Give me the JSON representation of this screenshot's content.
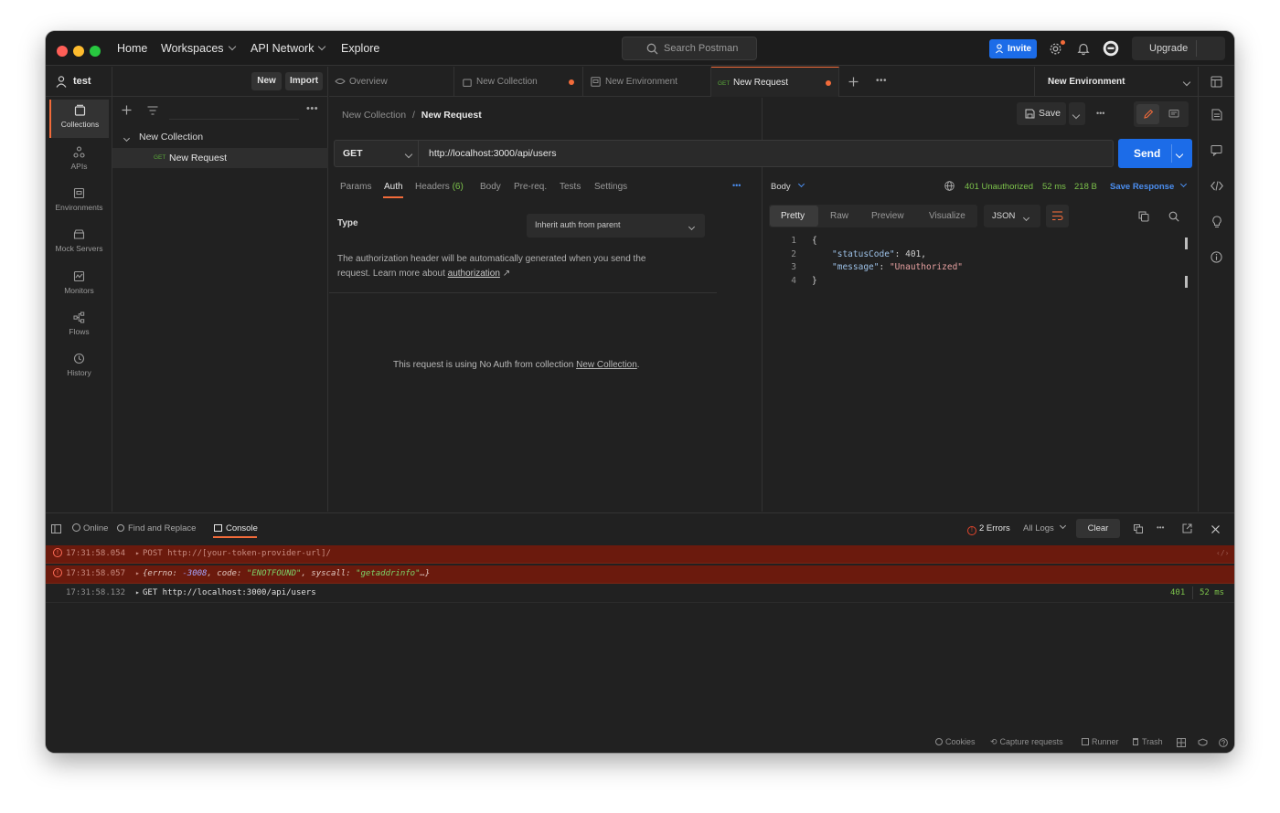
{
  "topnav": {
    "home": "Home",
    "workspaces": "Workspaces",
    "api_network": "API Network",
    "explore": "Explore",
    "search_placeholder": "Search Postman",
    "invite": "Invite",
    "upgrade": "Upgrade"
  },
  "workspace": {
    "name": "test",
    "new_label": "New",
    "import_label": "Import"
  },
  "rail": [
    {
      "label": "Collections",
      "icon": "collections-icon"
    },
    {
      "label": "APIs",
      "icon": "apis-icon"
    },
    {
      "label": "Environments",
      "icon": "environments-icon"
    },
    {
      "label": "Mock Servers",
      "icon": "mock-servers-icon"
    },
    {
      "label": "Monitors",
      "icon": "monitors-icon"
    },
    {
      "label": "Flows",
      "icon": "flows-icon"
    },
    {
      "label": "History",
      "icon": "history-icon"
    }
  ],
  "sidebar": {
    "collection_name": "New Collection",
    "request_method": "GET",
    "request_name": "New Request"
  },
  "tabs": [
    {
      "label": "Overview"
    },
    {
      "label": "New Collection"
    },
    {
      "label": "New Environment"
    },
    {
      "method": "GET",
      "label": "New Request"
    }
  ],
  "environment_select": "New Environment",
  "breadcrumb": {
    "collection": "New Collection",
    "separator": "/",
    "request": "New Request"
  },
  "save_label": "Save",
  "request": {
    "method": "GET",
    "url": "http://localhost:3000/api/users",
    "send": "Send",
    "subtabs": {
      "params": "Params",
      "auth": "Auth",
      "headers": "Headers",
      "headers_count": "(6)",
      "body": "Body",
      "prereq": "Pre-req.",
      "tests": "Tests",
      "settings": "Settings"
    },
    "auth": {
      "type_label": "Type",
      "type_value": "Inherit auth from parent",
      "info_line1": "The authorization header will be automatically generated when you send the",
      "info_line2_prefix": "request. Learn more about ",
      "info_link": "authorization",
      "info_arrow": "↗",
      "noauth_prefix": "This request is using No Auth from collection ",
      "noauth_link": "New Collection",
      "noauth_suffix": "."
    }
  },
  "response": {
    "body_label": "Body",
    "status": "401 Unauthorized",
    "time": "52 ms",
    "size": "218 B",
    "save_response": "Save Response",
    "views": {
      "pretty": "Pretty",
      "raw": "Raw",
      "preview": "Preview",
      "visualize": "Visualize"
    },
    "format": "JSON",
    "lines": [
      {
        "n": "1",
        "text": "{"
      },
      {
        "n": "2",
        "key": "\"statusCode\"",
        "sep": ": ",
        "val": "401",
        "tail": ","
      },
      {
        "n": "3",
        "key": "\"message\"",
        "sep": ": ",
        "val": "\"Unauthorized\"",
        "tail": ""
      },
      {
        "n": "4",
        "text": "}"
      }
    ]
  },
  "console": {
    "online": "Online",
    "find_replace": "Find and Replace",
    "console_tab": "Console",
    "errors": "2 Errors",
    "all_logs": "All Logs",
    "clear": "Clear",
    "rows": [
      {
        "time": "17:31:58.054",
        "text": "POST http://[your-token-provider-url]/"
      },
      {
        "time": "17:31:58.057",
        "obj_open": "{",
        "k1": "errno",
        "v1": "-3008",
        "k2": "code",
        "v2": "\"ENOTFOUND\"",
        "k3": "syscall",
        "v3": "\"getaddrinfo\"",
        "obj_close": "…}"
      },
      {
        "time": "17:31:58.132",
        "text": "GET http://localhost:3000/api/users",
        "status": "401",
        "duration": "52 ms"
      }
    ]
  },
  "footer": {
    "cookies": "Cookies",
    "capture": "Capture requests",
    "runner": "Runner",
    "trash": "Trash"
  },
  "colors": {
    "accent": "#f26b3a",
    "primary": "#1c6ce8",
    "success": "#7cc24b",
    "error": "#6b1a0d"
  }
}
